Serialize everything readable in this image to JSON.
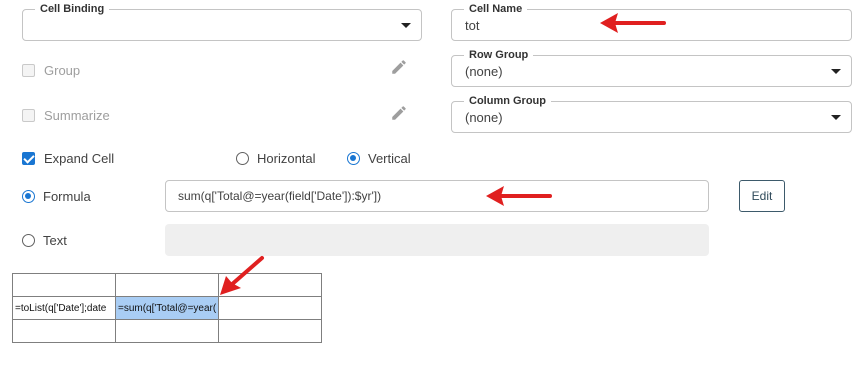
{
  "cell_binding": {
    "label": "Cell Binding",
    "value": ""
  },
  "cell_name": {
    "label": "Cell Name",
    "value": "tot"
  },
  "row_group": {
    "label": "Row Group",
    "value": "(none)"
  },
  "column_group": {
    "label": "Column Group",
    "value": "(none)"
  },
  "options": {
    "group": {
      "label": "Group",
      "checked": false,
      "disabled": true
    },
    "summarize": {
      "label": "Summarize",
      "checked": false,
      "disabled": true
    },
    "expand_cell": {
      "label": "Expand Cell",
      "checked": true
    }
  },
  "direction": {
    "horizontal": {
      "label": "Horizontal",
      "selected": false
    },
    "vertical": {
      "label": "Vertical",
      "selected": true
    }
  },
  "content_type": {
    "formula": {
      "label": "Formula",
      "selected": true,
      "value": "sum(q['Total@=year(field['Date']):$yr'])"
    },
    "text": {
      "label": "Text",
      "selected": false,
      "value": ""
    }
  },
  "edit_button": {
    "label": "Edit"
  },
  "grid": {
    "rows": [
      [
        "",
        "",
        ""
      ],
      [
        "=toList(q['Date'];date",
        "=sum(q['Total@=year(",
        ""
      ],
      [
        "",
        "",
        ""
      ]
    ],
    "selected_cell": "1.1"
  },
  "annotation_color": "#e02020"
}
